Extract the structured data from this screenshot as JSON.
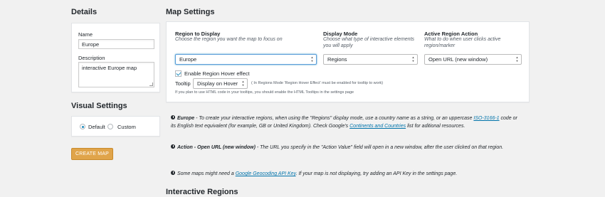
{
  "details": {
    "title": "Details",
    "name_label": "Name",
    "name_value": "Europe",
    "description_label": "Description",
    "description_value": "interactive Europe map"
  },
  "visual_settings": {
    "title": "Visual Settings",
    "options": [
      "Default",
      "Custom"
    ],
    "selected": "Default"
  },
  "create_button": "CREATE MAP",
  "map_settings": {
    "title": "Map Settings",
    "region": {
      "label": "Region to Display",
      "desc": "Choose the region you want the map to focus on",
      "value": "Europe"
    },
    "display_mode": {
      "label": "Display Mode",
      "desc": "Choose what type of interactive elements you will apply",
      "value": "Regions"
    },
    "active_action": {
      "label": "Active Region Action",
      "desc": "What to do when user clicks active region/marker",
      "value": "Open URL (new window)"
    },
    "hover_label": "Enable Region Hover effect",
    "hover_checked": true,
    "tooltip_label": "Tooltip",
    "tooltip_value": "Display on Hover",
    "tooltip_note": "( In Regions Mode 'Region Hover Effect' must be enabled for tooltip to work)",
    "html_note": "If you plan to use HTML code in your tooltips, you should enable the HTML Tooltips in the settings page"
  },
  "notes": {
    "europe_strong": "Europe",
    "europe_text1": " - To create your interactive regions, when using the \"Regions\" display mode, use a country name as a string, or an uppercase ",
    "europe_link1": "ISO-3166-1",
    "europe_text2": " code or its English text equivalent (for example, GB or United Kingdom). Check Google's ",
    "europe_link2": "Continents and Countries",
    "europe_text3": " list for aditional resources.",
    "action_strong": "Action - Open URL (new window)",
    "action_text": " - The URL you specify in the \"Action Value\" field will open in a new window, after the user clicked on that region.",
    "api_text1": "Some maps might need a ",
    "api_link": "Google Geocoding API Key",
    "api_text2": ". If your map is not displaying, try adding an API Key in the settings page."
  },
  "interactive_regions_title": "Interactive Regions",
  "colors": {
    "background": "#f1f1f1",
    "create_button": "#e0a44a",
    "link": "#0073aa",
    "focus_border": "#5b9dd9"
  }
}
